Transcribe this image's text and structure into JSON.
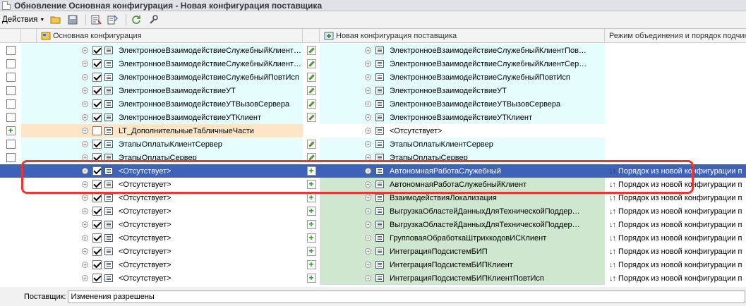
{
  "window": {
    "title": "Обновление Основная конфигурация - Новая конфигурация поставщика"
  },
  "toolbar": {
    "actions_label": "Действия"
  },
  "columns": {
    "main": "Основная конфигурация",
    "vendor": "Новая конфигурация поставщика",
    "mode": "Режим объединения и порядок подчин"
  },
  "rows": [
    {
      "left": "ЭлектронноеВзаимодействиеСлужебныйКлиент…",
      "right": "ЭлектронноеВзаимодействиеСлужебныйКлиентПов…",
      "mode": ""
    },
    {
      "left": "ЭлектронноеВзаимодействиеСлужебныйКлиент…",
      "right": "ЭлектронноеВзаимодействиеСлужебныйКлиентСер…",
      "mode": ""
    },
    {
      "left": "ЭлектронноеВзаимодействиеСлужебныйПовтИсп",
      "right": "ЭлектронноеВзаимодействиеСлужебныйПовтИсп",
      "mode": ""
    },
    {
      "left": "ЭлектронноеВзаимодействиеУТ",
      "right": "ЭлектронноеВзаимодействиеУТ",
      "mode": ""
    },
    {
      "left": "ЭлектронноеВзаимодействиеУТВызовСервера",
      "right": "ЭлектронноеВзаимодействиеУТВызовСервера",
      "mode": ""
    },
    {
      "left": "ЭлектронноеВзаимодействиеУТКлиент",
      "right": "ЭлектронноеВзаимодействиеУТКлиент",
      "mode": ""
    },
    {
      "left": "LT_ДополнительныеТабличныеЧасти",
      "right": "<Отсутствует>",
      "mode": ""
    },
    {
      "left": "ЭтапыОплатыКлиентСервер",
      "right": "ЭтапыОплатыКлиентСервер",
      "mode": ""
    },
    {
      "left": "ЭтапыОплатыСервер",
      "right": "ЭтапыОплатыСервер",
      "mode": ""
    },
    {
      "left": "<Отсутствует>",
      "right": "АвтономнаяРаботаСлужебный",
      "mode": "Порядок из новой конфигурации п"
    },
    {
      "left": "<Отсутствует>",
      "right": "АвтономнаяРаботаСлужебныйКлиент",
      "mode": "Порядок из новой конфигурации п"
    },
    {
      "left": "<Отсутствует>",
      "right": "ВзаимодействияЛокализация",
      "mode": "Порядок из новой конфигурации п"
    },
    {
      "left": "<Отсутствует>",
      "right": "ВыгрузкаОбластейДанныхДляТехническойПоддер…",
      "mode": "Порядок из новой конфигурации п"
    },
    {
      "left": "<Отсутствует>",
      "right": "ВыгрузкаОбластейДанныхДляТехническойПоддер…",
      "mode": "Порядок из новой конфигурации п"
    },
    {
      "left": "<Отсутствует>",
      "right": "ГрупповаяОбработкаШтрихкодовИСКлиент",
      "mode": "Порядок из новой конфигурации п"
    },
    {
      "left": "<Отсутствует>",
      "right": "ИнтеграцияПодсистемБИП",
      "mode": "Порядок из новой конфигурации п"
    },
    {
      "left": "<Отсутствует>",
      "right": "ИнтеграцияПодсистемБИПКлиент",
      "mode": "Порядок из новой конфигурации п"
    },
    {
      "left": "<Отсутствует>",
      "right": "ИнтеграцияПодсистемБИПКлиентПовтИсп",
      "mode": "Порядок из новой конфигурации п"
    }
  ],
  "status": {
    "label": "Поставщик:",
    "value": "Изменения разрешены"
  },
  "colors": {
    "selection": "#3e62b8",
    "highlight": "#e53935",
    "cyan": "#e6fdfd",
    "green": "#cfe6cf",
    "peach": "#fde5c8"
  }
}
